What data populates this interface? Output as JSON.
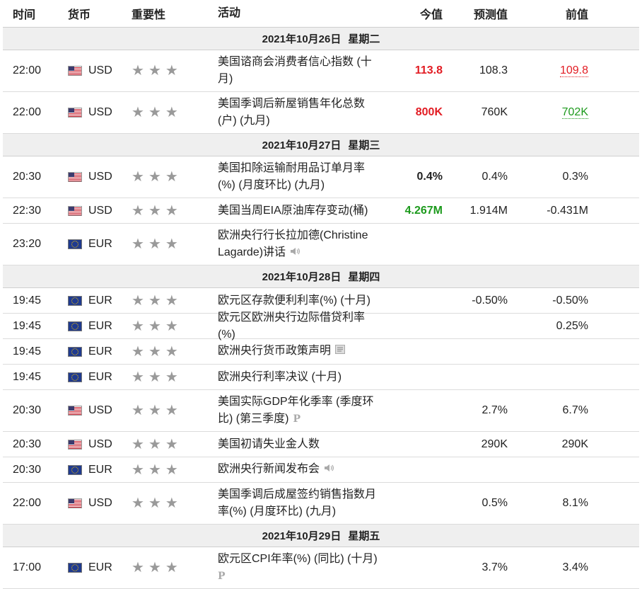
{
  "header": {
    "time": "时间",
    "currency": "货币",
    "importance": "重要性",
    "activity": "活动",
    "actual": "今值",
    "forecast": "预测值",
    "previous": "前值"
  },
  "days": [
    {
      "date": "2021年10月26日",
      "weekday": "星期二"
    },
    {
      "date": "2021年10月27日",
      "weekday": "星期三"
    },
    {
      "date": "2021年10月28日",
      "weekday": "星期四"
    },
    {
      "date": "2021年10月29日",
      "weekday": "星期五"
    }
  ],
  "events": [
    {
      "time": "22:00",
      "currency": "USD",
      "name": "美国谘商会消费者信心指数 (十月)",
      "actual": "113.8",
      "forecast": "108.3",
      "previous": "109.8"
    },
    {
      "time": "22:00",
      "currency": "USD",
      "name": "美国季调后新屋销售年化总数(户) (九月)",
      "actual": "800K",
      "forecast": "760K",
      "previous": "702K"
    },
    {
      "time": "20:30",
      "currency": "USD",
      "name": "美国扣除运输耐用品订单月率(%) (月度环比) (九月)",
      "actual": "0.4%",
      "forecast": "0.4%",
      "previous": "0.3%"
    },
    {
      "time": "22:30",
      "currency": "USD",
      "name": "美国当周EIA原油库存变动(桶)",
      "actual": "4.267M",
      "forecast": "1.914M",
      "previous": "-0.431M"
    },
    {
      "time": "23:20",
      "currency": "EUR",
      "name": "欧洲央行行长拉加德(Christine Lagarde)讲话",
      "actual": "",
      "forecast": "",
      "previous": ""
    },
    {
      "time": "19:45",
      "currency": "EUR",
      "name": "欧元区存款便利利率(%) (十月)",
      "actual": "",
      "forecast": "-0.50%",
      "previous": "-0.50%"
    },
    {
      "time": "19:45",
      "currency": "EUR",
      "name": "欧元区欧洲央行边际借贷利率(%)",
      "actual": "",
      "forecast": "",
      "previous": "0.25%"
    },
    {
      "time": "19:45",
      "currency": "EUR",
      "name": "欧洲央行货币政策声明",
      "actual": "",
      "forecast": "",
      "previous": ""
    },
    {
      "time": "19:45",
      "currency": "EUR",
      "name": "欧洲央行利率决议 (十月)",
      "actual": "",
      "forecast": "",
      "previous": ""
    },
    {
      "time": "20:30",
      "currency": "USD",
      "name": "美国实际GDP年化季率 (季度环比) (第三季度)",
      "actual": "",
      "forecast": "2.7%",
      "previous": "6.7%"
    },
    {
      "time": "20:30",
      "currency": "USD",
      "name": "美国初请失业金人数",
      "actual": "",
      "forecast": "290K",
      "previous": "290K"
    },
    {
      "time": "20:30",
      "currency": "EUR",
      "name": "欧洲央行新闻发布会",
      "actual": "",
      "forecast": "",
      "previous": ""
    },
    {
      "time": "22:00",
      "currency": "USD",
      "name": "美国季调后成屋签约销售指数月率(%) (月度环比) (九月)",
      "actual": "",
      "forecast": "0.5%",
      "previous": "8.1%"
    },
    {
      "time": "17:00",
      "currency": "EUR",
      "name": "欧元区CPI年率(%) (同比) (十月)",
      "actual": "",
      "forecast": "3.7%",
      "previous": "3.4%"
    }
  ],
  "colors": {
    "actual_up": "#e21c23",
    "actual_down": "#1d9a1d",
    "star": "#9a9a9a"
  },
  "icons": {
    "speech": "speaker-icon",
    "document": "document-icon",
    "preliminary": "preliminary-p-icon"
  },
  "preliminary_mark": "P"
}
